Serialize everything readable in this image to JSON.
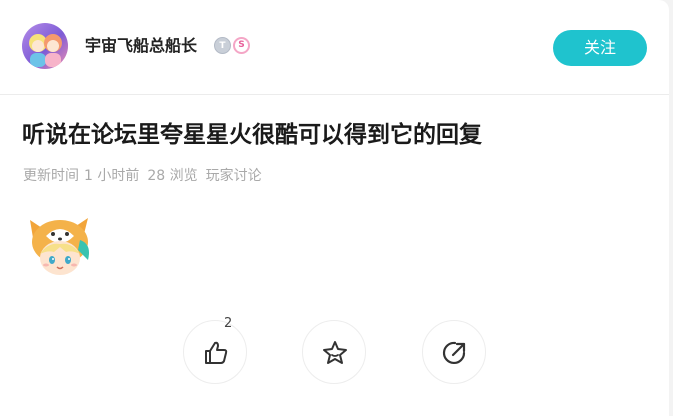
{
  "author": {
    "name": "宇宙飞船总船长",
    "badges": [
      {
        "icon": "level-badge-icon",
        "text": "T"
      },
      {
        "icon": "creator-badge-icon",
        "text": "S"
      }
    ],
    "follow_label": "关注"
  },
  "post": {
    "title": "听说在论坛里夸星星火很酷可以得到它的回复",
    "meta": {
      "update_label": "更新时间",
      "update_time": "1 小时前",
      "views": "28 浏览",
      "category": "玩家讨论"
    },
    "sticker_icon": "fox-girl-sticker-icon"
  },
  "actions": {
    "like_count": "2",
    "like_icon": "thumbs-up-icon",
    "favorite_icon": "star-icon",
    "share_icon": "share-icon"
  },
  "colors": {
    "accent": "#1fc3ce",
    "title": "#1a1a1a",
    "meta": "#a9a9a9"
  }
}
